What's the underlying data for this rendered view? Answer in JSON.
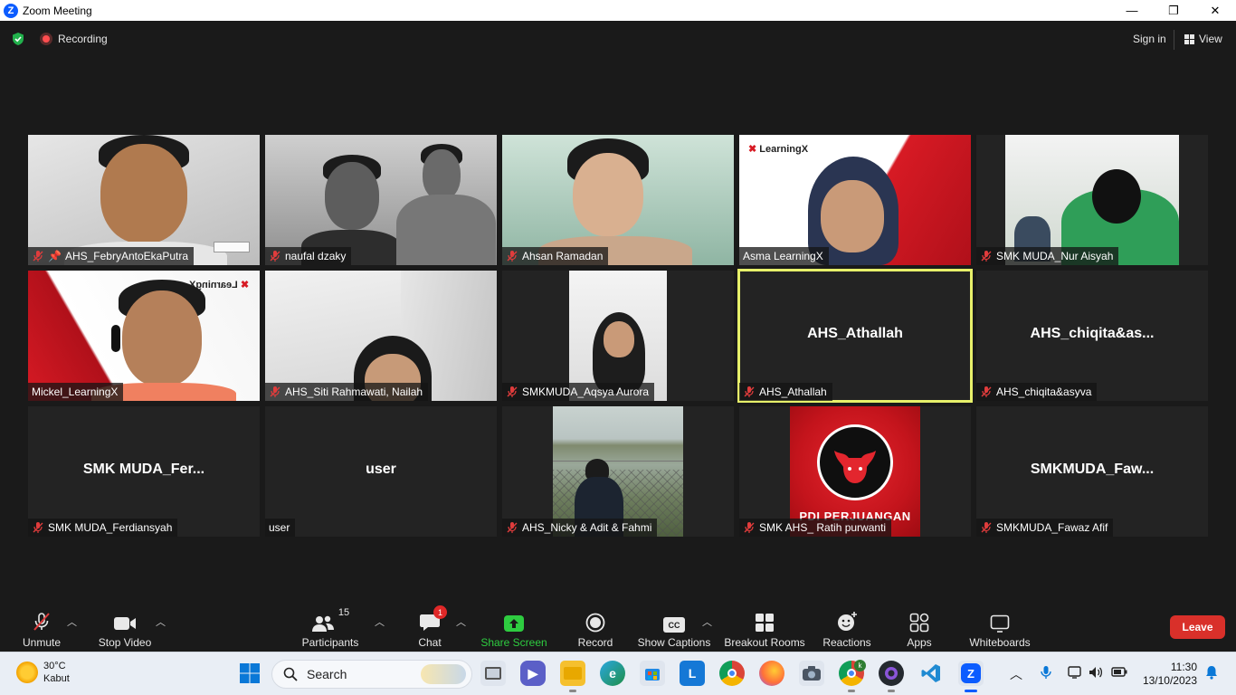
{
  "window": {
    "title": "Zoom Meeting",
    "controls": [
      "—",
      "❐",
      "✕"
    ]
  },
  "topbar": {
    "recording_label": "Recording",
    "signin_label": "Sign in",
    "view_label": "View"
  },
  "tiles": [
    {
      "name": "AHS_FebryAntoEkaPutra",
      "pinned": true
    },
    {
      "name": "naufal dzaky"
    },
    {
      "name": "Ahsan Ramadan"
    },
    {
      "name": "Asma LearningX",
      "logo": "LearningX"
    },
    {
      "name": "SMK MUDA_Nur Aisyah"
    },
    {
      "name": "Mickel_LearningX",
      "logo": "LearningX"
    },
    {
      "name": "AHS_Siti Rahmawati, Nailah"
    },
    {
      "name": "SMKMUDA_Aqsya Aurora"
    },
    {
      "name": "AHS_Athallah",
      "display_name": "AHS_Athallah"
    },
    {
      "name": "AHS_chiqita&asyva",
      "display_name": "AHS_chiqita&as..."
    },
    {
      "name": "SMK MUDA_Ferdiansyah",
      "display_name": "SMK  MUDA_Fer..."
    },
    {
      "name": "user",
      "display_name": "user"
    },
    {
      "name": "AHS_Nicky & Adit & Fahmi"
    },
    {
      "name": "SMK AHS_ Ratih purwanti",
      "logo": "PDI PERJUANGAN"
    },
    {
      "name": "SMKMUDA_Fawaz Afif",
      "display_name": "SMKMUDA_Faw..."
    }
  ],
  "toolbar": {
    "unmute": "Unmute",
    "stop_video": "Stop Video",
    "participants": "Participants",
    "participants_count": "15",
    "chat": "Chat",
    "chat_badge": "1",
    "share_screen": "Share Screen",
    "record": "Record",
    "show_captions": "Show Captions",
    "cc": "CC",
    "breakout_rooms": "Breakout Rooms",
    "reactions": "Reactions",
    "apps": "Apps",
    "whiteboards": "Whiteboards",
    "leave": "Leave"
  },
  "taskbar": {
    "temperature": "30°C",
    "weather": "Kabut",
    "search_placeholder": "Search",
    "time": "11:30",
    "date": "13/10/2023",
    "learning_app_letter": "L",
    "zoom_letter": "Z",
    "chrome_profile_letter": "k"
  },
  "colors": {
    "accent": "#0b5cff",
    "active_speaker": "#e7f06a",
    "leave": "#d9302a",
    "share": "#2ecc40",
    "mic_off": "#e03c3c"
  }
}
